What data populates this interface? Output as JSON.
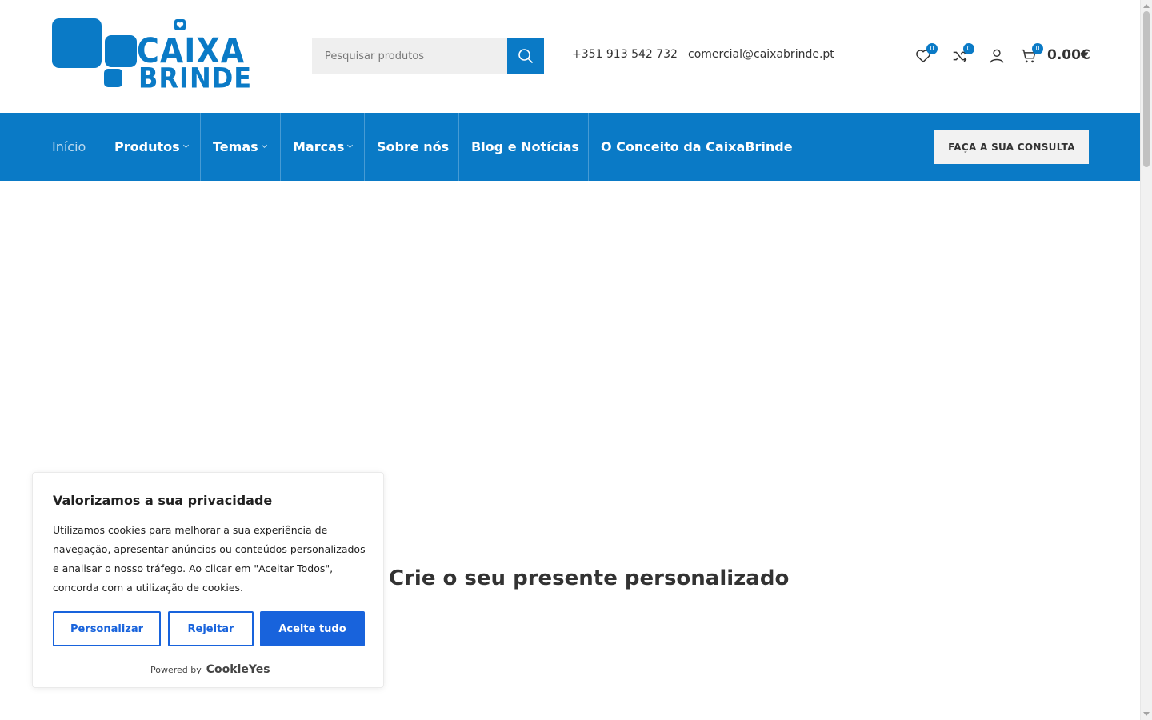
{
  "brand": {
    "logo_line1": "CAIXA",
    "logo_line2": "BRINDE",
    "color": "#0a7ac6"
  },
  "search": {
    "placeholder": "Pesquisar produtos"
  },
  "contact": {
    "phone": "+351 913 542 732",
    "email": "comercial@caixabrinde.pt"
  },
  "header_icons": {
    "wishlist_count": "0",
    "compare_count": "0",
    "cart_count": "0",
    "cart_total": "0.00€"
  },
  "nav": {
    "items": [
      {
        "label": "Início"
      },
      {
        "label": "Produtos"
      },
      {
        "label": "Temas"
      },
      {
        "label": "Marcas"
      },
      {
        "label": "Sobre nós"
      },
      {
        "label": "Blog e Notícias"
      },
      {
        "label": "O Conceito da CaixaBrinde"
      }
    ],
    "cta": "FAÇA A SUA CONSULTA"
  },
  "main": {
    "headline": "Crie o seu presente personalizado"
  },
  "cookie": {
    "title": "Valorizamos a sua privacidade",
    "text": "Utilizamos cookies para melhorar a sua experiência de navegação, apresentar anúncios ou conteúdos personalizados e analisar o nosso tráfego. Ao clicar em \"Aceitar Todos\", concorda com a utilização de cookies.",
    "customize": "Personalizar",
    "reject": "Rejeitar",
    "accept": "Aceite tudo",
    "powered_by": "Powered by",
    "provider": "CookieYes",
    "accent": "#1863dc"
  }
}
